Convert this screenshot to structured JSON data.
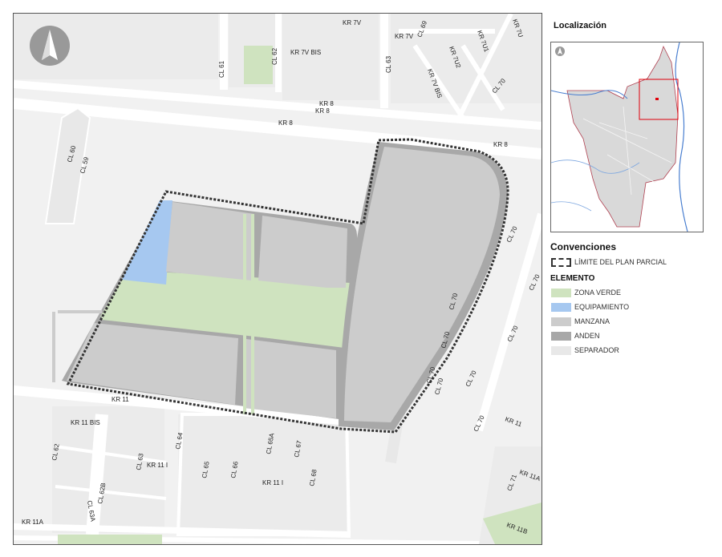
{
  "map": {
    "north_arrow": "north-arrow-icon",
    "street_labels": [
      "KR 7V",
      "KR 7V",
      "CL 69",
      "KR 7U1",
      "KR 7U",
      "KR 7U2",
      "KR 7V BIS",
      "KR 7V BIS",
      "CL 61",
      "CL 62",
      "CL 63",
      "CL 70",
      "KR 8",
      "KR 8",
      "KR 8",
      "KR 8",
      "CL 60",
      "CL 59",
      "CL 70",
      "CL 70",
      "CL 70",
      "CL 70",
      "CL 70",
      "CL 70",
      "CL 70",
      "CL 70",
      "CL 70",
      "KR 11",
      "KR 11",
      "KR 11 BIS",
      "CL 64",
      "CL 62",
      "CL 63",
      "KR 11 I",
      "CL 65",
      "CL 66",
      "CL 65A",
      "CL 67",
      "CL 68",
      "KR 11 I",
      "CL 63A",
      "CL 62B",
      "KR 11A",
      "KR 11A",
      "CL 71",
      "KR 11B"
    ]
  },
  "sidebar": {
    "localizacion_title": "Localización",
    "convenciones_title": "Convenciones",
    "elemento_title": "ELEMENTO",
    "limite_label": "LÍMITE DEL PLAN PARCIAL",
    "legend": [
      {
        "label": "ZONA VERDE",
        "color": "#cfe3bf"
      },
      {
        "label": "EQUIPAMIENTO",
        "color": "#a6c8f0"
      },
      {
        "label": "MANZANA",
        "color": "#cccccc"
      },
      {
        "label": "ANDEN",
        "color": "#a8a8a8"
      },
      {
        "label": "SEPARADOR",
        "color": "#e8e8e8"
      }
    ]
  },
  "colors": {
    "background": "#f1f1f1",
    "road": "#ffffff",
    "manzana": "#cccccc",
    "anden": "#a8a8a8",
    "zona_verde": "#cfe3bf",
    "equipamiento": "#a6c8f0",
    "separador": "#e8e8e8",
    "inset_highlight": "#e0000a"
  }
}
